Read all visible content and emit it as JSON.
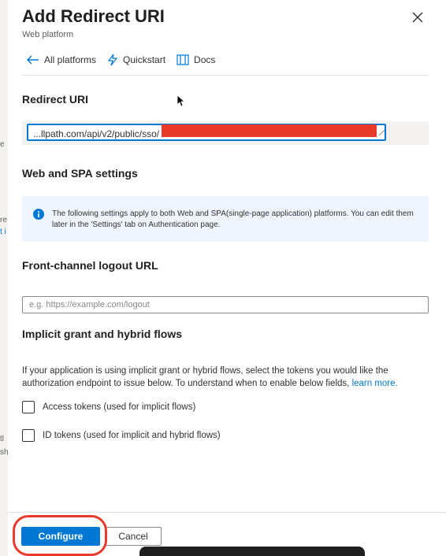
{
  "background_fragments": [
    "e",
    "re",
    "t i",
    "tl",
    "sh"
  ],
  "header": {
    "title": "Add Redirect URI",
    "subtitle": "Web platform",
    "close_icon": "close-icon"
  },
  "nav": {
    "all_platforms": "All platforms",
    "quickstart": "Quickstart",
    "docs": "Docs"
  },
  "redirect_uri": {
    "heading": "Redirect URI",
    "value": "...llpath.com/api/v2/public/sso/"
  },
  "web_spa": {
    "heading": "Web and SPA settings",
    "info_text": "The following settings apply to both Web and SPA(single-page application) platforms. You can edit them later in the 'Settings' tab on Authentication page."
  },
  "logout": {
    "heading": "Front-channel logout URL",
    "placeholder": "e.g. https://example.com/logout"
  },
  "implicit": {
    "heading": "Implicit grant and hybrid flows",
    "description": "If your application is using implicit grant or hybrid flows, select the tokens you would like the authorization endpoint to issue below. To understand when to enable below fields, ",
    "learn_more": "learn more.",
    "access_tokens_label": "Access tokens (used for implicit flows)",
    "id_tokens_label": "ID tokens (used for implicit and hybrid flows)"
  },
  "footer": {
    "configure": "Configure",
    "cancel": "Cancel"
  },
  "colors": {
    "accent": "#0078d4",
    "annotation": "#e8392b",
    "redaction": "#e8392b"
  }
}
